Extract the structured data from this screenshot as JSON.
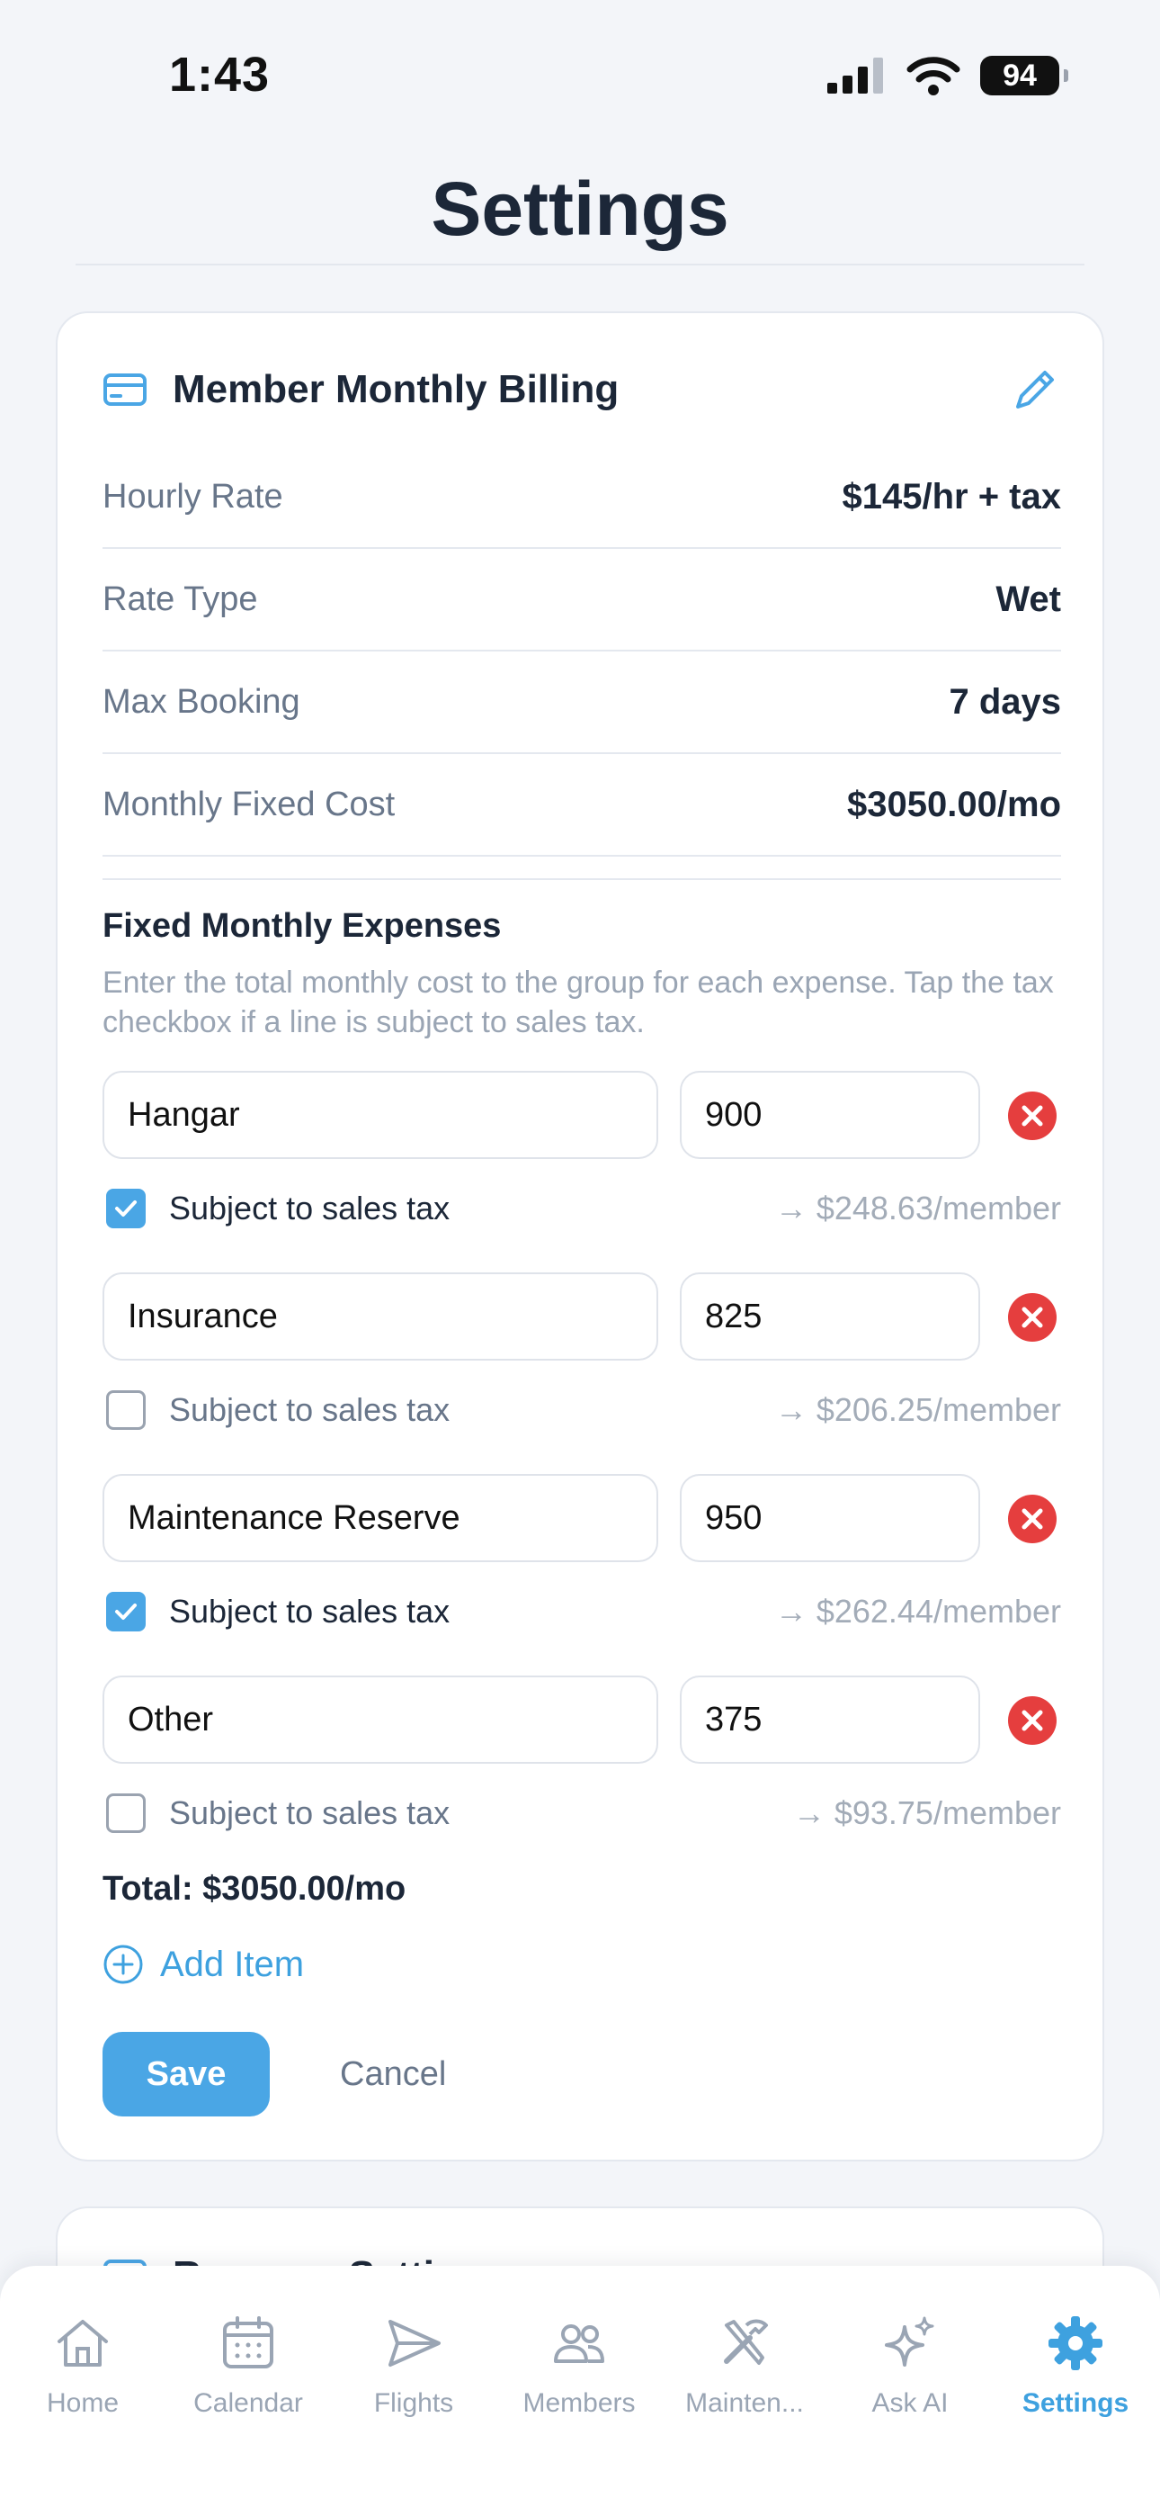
{
  "status_bar": {
    "time": "1:43",
    "battery": "94"
  },
  "page_title": "Settings",
  "billing_card": {
    "title": "Member Monthly Billing",
    "rows": [
      {
        "label": "Hourly Rate",
        "value": "$145/hr + tax"
      },
      {
        "label": "Rate Type",
        "value": "Wet"
      },
      {
        "label": "Max Booking",
        "value": "7 days"
      },
      {
        "label": "Monthly Fixed Cost",
        "value": "$3050.00/mo"
      }
    ],
    "expenses_title": "Fixed Monthly Expenses",
    "expenses_help": "Enter the total monthly cost to the group for each expense. Tap the tax checkbox if a line is subject to sales tax.",
    "tax_label": "Subject to sales tax",
    "expenses": [
      {
        "name": "Hangar",
        "amount": "900",
        "taxed": true,
        "per_member": "→ $248.63/member"
      },
      {
        "name": "Insurance",
        "amount": "825",
        "taxed": false,
        "per_member": "→ $206.25/member"
      },
      {
        "name": "Maintenance Reserve",
        "amount": "950",
        "taxed": true,
        "per_member": "→ $262.44/member"
      },
      {
        "name": "Other",
        "amount": "375",
        "taxed": false,
        "per_member": "→ $93.75/member"
      }
    ],
    "total": "Total: $3050.00/mo",
    "add_item_label": "Add Item",
    "save_label": "Save",
    "cancel_label": "Cancel"
  },
  "second_card": {
    "title": "Revenue Settings"
  },
  "tab_bar": {
    "tabs": [
      {
        "label": "Home",
        "icon": "home-icon",
        "active": false
      },
      {
        "label": "Calendar",
        "icon": "calendar-icon",
        "active": false
      },
      {
        "label": "Flights",
        "icon": "paper-plane-icon",
        "active": false
      },
      {
        "label": "Members",
        "icon": "members-icon",
        "active": false
      },
      {
        "label": "Mainten...",
        "icon": "tools-icon",
        "active": false
      },
      {
        "label": "Ask AI",
        "icon": "sparkles-icon",
        "active": false
      },
      {
        "label": "Settings",
        "icon": "gear-icon",
        "active": true
      }
    ]
  },
  "colors": {
    "accent": "#4aa6e5",
    "danger": "#e53e3e",
    "background": "#f3f5f9",
    "text_primary": "#1c2738",
    "text_secondary": "#68768a"
  }
}
